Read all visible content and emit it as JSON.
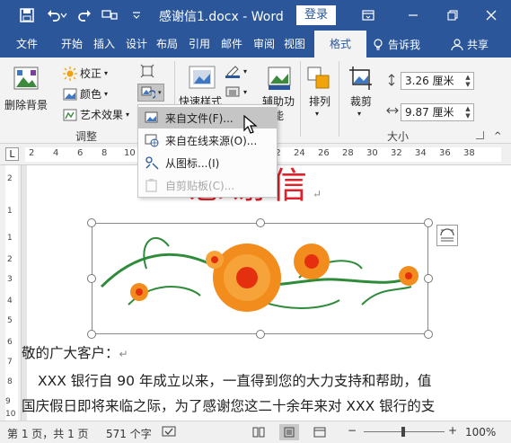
{
  "titlebar": {
    "title": "感谢信1.docx - Word",
    "login_label": "登录"
  },
  "tabs": [
    {
      "label": "文件"
    },
    {
      "label": "开始"
    },
    {
      "label": "插入"
    },
    {
      "label": "设计"
    },
    {
      "label": "布局"
    },
    {
      "label": "引用"
    },
    {
      "label": "邮件"
    },
    {
      "label": "审阅"
    },
    {
      "label": "视图"
    },
    {
      "label": "格式"
    }
  ],
  "tell_me": "告诉我",
  "share": "共享",
  "ribbon": {
    "remove_bg": "删除背景",
    "corrections": "校正",
    "color": "颜色",
    "artistic_effects": "艺术效果",
    "group_adjust": "调整",
    "quick_styles": "快速样式",
    "alt_text": "辅助功",
    "alt_text_line2": "能",
    "arrange": "排列",
    "crop": "裁剪",
    "height": "3.26 厘米",
    "width": "9.87 厘米",
    "group_size": "大小"
  },
  "dropdown": {
    "items": [
      {
        "label": "来自文件(F)..."
      },
      {
        "label": "来自在线来源(O)..."
      },
      {
        "label": "从图标...(I)"
      },
      {
        "label": "自剪贴板(C)..."
      }
    ]
  },
  "ruler": {
    "numbers": [
      "L",
      "2",
      "4",
      "6",
      "8",
      "10",
      "12",
      "14",
      "16",
      "18",
      "20",
      "22",
      "24",
      "26",
      "28",
      "30",
      "32",
      "34",
      "36",
      "38"
    ],
    "vnumbers": [
      "2",
      "1",
      "1",
      "2",
      "3",
      "4",
      "5",
      "6",
      "7",
      "8",
      "9",
      "10"
    ]
  },
  "document": {
    "title": "感谢信",
    "greeting": "敬的广大客户：",
    "line1": "XXX 银行自 90 年成立以来，一直得到您的大力支持和帮助，值",
    "line2": "国庆假日即将来临之际，为了感谢您这二十余年来对 XXX 银行的支"
  },
  "statusbar": {
    "page": "第 1 页，共 1 页",
    "words": "571 个字",
    "zoom": "100%"
  },
  "colors": {
    "accent": "#2b579a",
    "title_red": "#e0202a"
  }
}
